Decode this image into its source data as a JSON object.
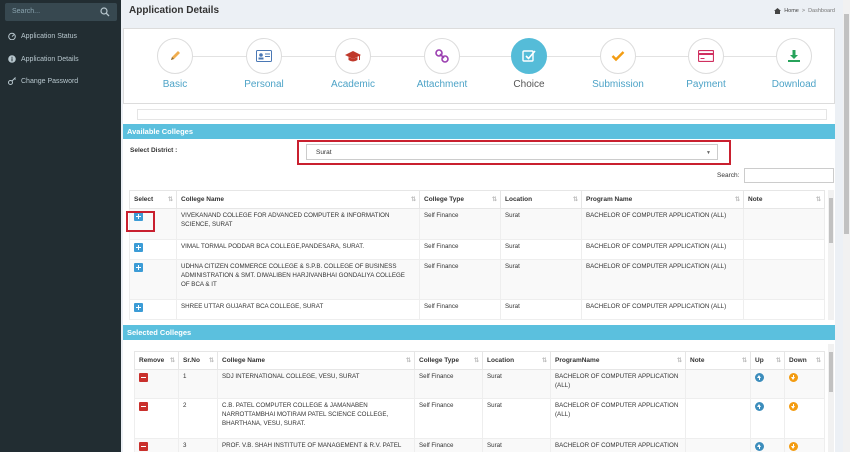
{
  "sidebar": {
    "search_placeholder": "Search...",
    "items": [
      {
        "label": "Application Status",
        "icon": "dashboard-icon"
      },
      {
        "label": "Application Details",
        "icon": "info-icon"
      },
      {
        "label": "Change Password",
        "icon": "key-icon"
      }
    ]
  },
  "header": {
    "title": "Application Details",
    "breadcrumb": {
      "home": "Home",
      "sep": ">",
      "current": "Dashboard"
    }
  },
  "steps": [
    {
      "label": "Basic",
      "icon": "pencil-icon",
      "active": false
    },
    {
      "label": "Personal",
      "icon": "id-card-icon",
      "active": false
    },
    {
      "label": "Academic",
      "icon": "graduation-cap-icon",
      "active": false
    },
    {
      "label": "Attachment",
      "icon": "link-icon",
      "active": false
    },
    {
      "label": "Choice",
      "icon": "checkbox-icon",
      "active": true
    },
    {
      "label": "Submission",
      "icon": "checkmark-icon",
      "active": false
    },
    {
      "label": "Payment",
      "icon": "credit-card-icon",
      "active": false
    },
    {
      "label": "Download",
      "icon": "download-icon",
      "active": false
    }
  ],
  "available": {
    "title": "Available Colleges",
    "district_label": "Select District :",
    "district_value": "Surat",
    "search_label": "Search:",
    "columns": [
      "Select",
      "College Name",
      "College Type",
      "Location",
      "Program Name",
      "Note"
    ],
    "rows": [
      {
        "name": "VIVEKANAND COLLEGE FOR ADVANCED COMPUTER & INFORMATION SCIENCE, SURAT",
        "type": "Self Finance",
        "location": "Surat",
        "program": "BACHELOR OF COMPUTER APPLICATION (ALL)",
        "note": ""
      },
      {
        "name": "VIMAL TORMAL PODDAR BCA COLLEGE,PANDESARA, SURAT.",
        "type": "Self Finance",
        "location": "Surat",
        "program": "BACHELOR OF COMPUTER APPLICATION (ALL)",
        "note": ""
      },
      {
        "name": "UDHNA CITIZEN COMMERCE COLLEGE & S.P.B. COLLEGE OF BUSINESS ADMINISTRATION & SMT. DIWALIBEN HARJIVANBHAI GONDALIYA COLLEGE OF BCA & IT",
        "type": "Self Finance",
        "location": "Surat",
        "program": "BACHELOR OF COMPUTER APPLICATION (ALL)",
        "note": ""
      },
      {
        "name": "SHREE UTTAR GUJARAT BCA COLLEGE, SURAT",
        "type": "Self Finance",
        "location": "Surat",
        "program": "BACHELOR OF COMPUTER APPLICATION (ALL)",
        "note": ""
      }
    ]
  },
  "selected": {
    "title": "Selected Colleges",
    "columns": [
      "Remove",
      "Sr.No",
      "College Name",
      "College Type",
      "Location",
      "ProgramName",
      "Note",
      "Up",
      "Down"
    ],
    "rows": [
      {
        "sr": "1",
        "name": "SDJ INTERNATIONAL COLLEGE, VESU, SURAT",
        "type": "Self Finance",
        "location": "Surat",
        "program": "BACHELOR OF COMPUTER APPLICATION (ALL)",
        "note": ""
      },
      {
        "sr": "2",
        "name": "C.B. PATEL COMPUTER COLLEGE & JAMANABEN NARROTTAMBHAI MOTIRAM PATEL SCIENCE COLLEGE, BHARTHANA, VESU, SURAT.",
        "type": "Self Finance",
        "location": "Surat",
        "program": "BACHELOR OF COMPUTER APPLICATION (ALL)",
        "note": ""
      },
      {
        "sr": "3",
        "name": "PROF. V.B. SHAH INSTITUTE OF MANAGEMENT & R.V. PATEL",
        "type": "Self Finance",
        "location": "Surat",
        "program": "BACHELOR OF COMPUTER APPLICATION",
        "note": ""
      }
    ]
  },
  "colors": {
    "accent": "#5bc0de",
    "sidebar": "#222d32",
    "highlight": "#c9202f",
    "step_active": "#55bcd8"
  }
}
